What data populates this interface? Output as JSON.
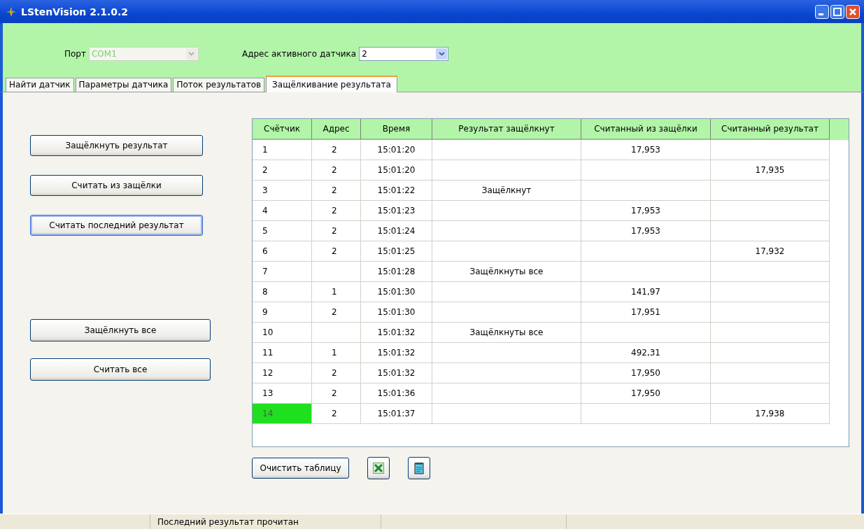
{
  "window": {
    "title": "LStenVision 2.1.0.2"
  },
  "port": {
    "label": "Порт",
    "value": "COM1",
    "disabled": true
  },
  "address": {
    "label": "Адрес активного датчика",
    "value": "2",
    "disabled": false
  },
  "tabs": [
    {
      "label": "Найти датчик",
      "selected": false
    },
    {
      "label": "Параметры датчика",
      "selected": false
    },
    {
      "label": "Поток результатов",
      "selected": false
    },
    {
      "label": "Защёлкивание результата",
      "selected": true
    }
  ],
  "action_groups": [
    {
      "buttons": [
        {
          "label": "Защёлкнуть результат",
          "focused": false
        },
        {
          "label": "Считать из защёлки",
          "focused": false
        },
        {
          "label": "Считать последний результат",
          "focused": true
        }
      ]
    },
    {
      "buttons": [
        {
          "label": "Защёлкнуть все",
          "focused": false
        },
        {
          "label": "Считать все",
          "focused": false
        }
      ]
    }
  ],
  "table": {
    "columns": [
      "Счётчик",
      "Адрес",
      "Время",
      "Результат защёлкнут",
      "Считанный из защёлки",
      "Считанный результат"
    ],
    "rows": [
      {
        "cells": [
          "1",
          "2",
          "15:01:20",
          "",
          "17,953",
          ""
        ],
        "highlighted": false
      },
      {
        "cells": [
          "2",
          "2",
          "15:01:20",
          "",
          "",
          "17,935"
        ],
        "highlighted": false
      },
      {
        "cells": [
          "3",
          "2",
          "15:01:22",
          "Защёлкнут",
          "",
          ""
        ],
        "highlighted": false
      },
      {
        "cells": [
          "4",
          "2",
          "15:01:23",
          "",
          "17,953",
          ""
        ],
        "highlighted": false
      },
      {
        "cells": [
          "5",
          "2",
          "15:01:24",
          "",
          "17,953",
          ""
        ],
        "highlighted": false
      },
      {
        "cells": [
          "6",
          "2",
          "15:01:25",
          "",
          "",
          "17,932"
        ],
        "highlighted": false
      },
      {
        "cells": [
          "7",
          "",
          "15:01:28",
          "Защёлкнуты все",
          "",
          ""
        ],
        "highlighted": false
      },
      {
        "cells": [
          "8",
          "1",
          "15:01:30",
          "",
          "141,97",
          ""
        ],
        "highlighted": false
      },
      {
        "cells": [
          "9",
          "2",
          "15:01:30",
          "",
          "17,951",
          ""
        ],
        "highlighted": false
      },
      {
        "cells": [
          "10",
          "",
          "15:01:32",
          "Защёлкнуты все",
          "",
          ""
        ],
        "highlighted": false
      },
      {
        "cells": [
          "11",
          "1",
          "15:01:32",
          "",
          "492,31",
          ""
        ],
        "highlighted": false
      },
      {
        "cells": [
          "12",
          "2",
          "15:01:32",
          "",
          "17,950",
          ""
        ],
        "highlighted": false
      },
      {
        "cells": [
          "13",
          "2",
          "15:01:36",
          "",
          "17,950",
          ""
        ],
        "highlighted": false
      },
      {
        "cells": [
          "14",
          "2",
          "15:01:37",
          "",
          "",
          "17,938"
        ],
        "highlighted": true
      }
    ]
  },
  "clear_button": "Очистить таблицу",
  "status_bar": {
    "message": "Последний результат прочитан"
  }
}
